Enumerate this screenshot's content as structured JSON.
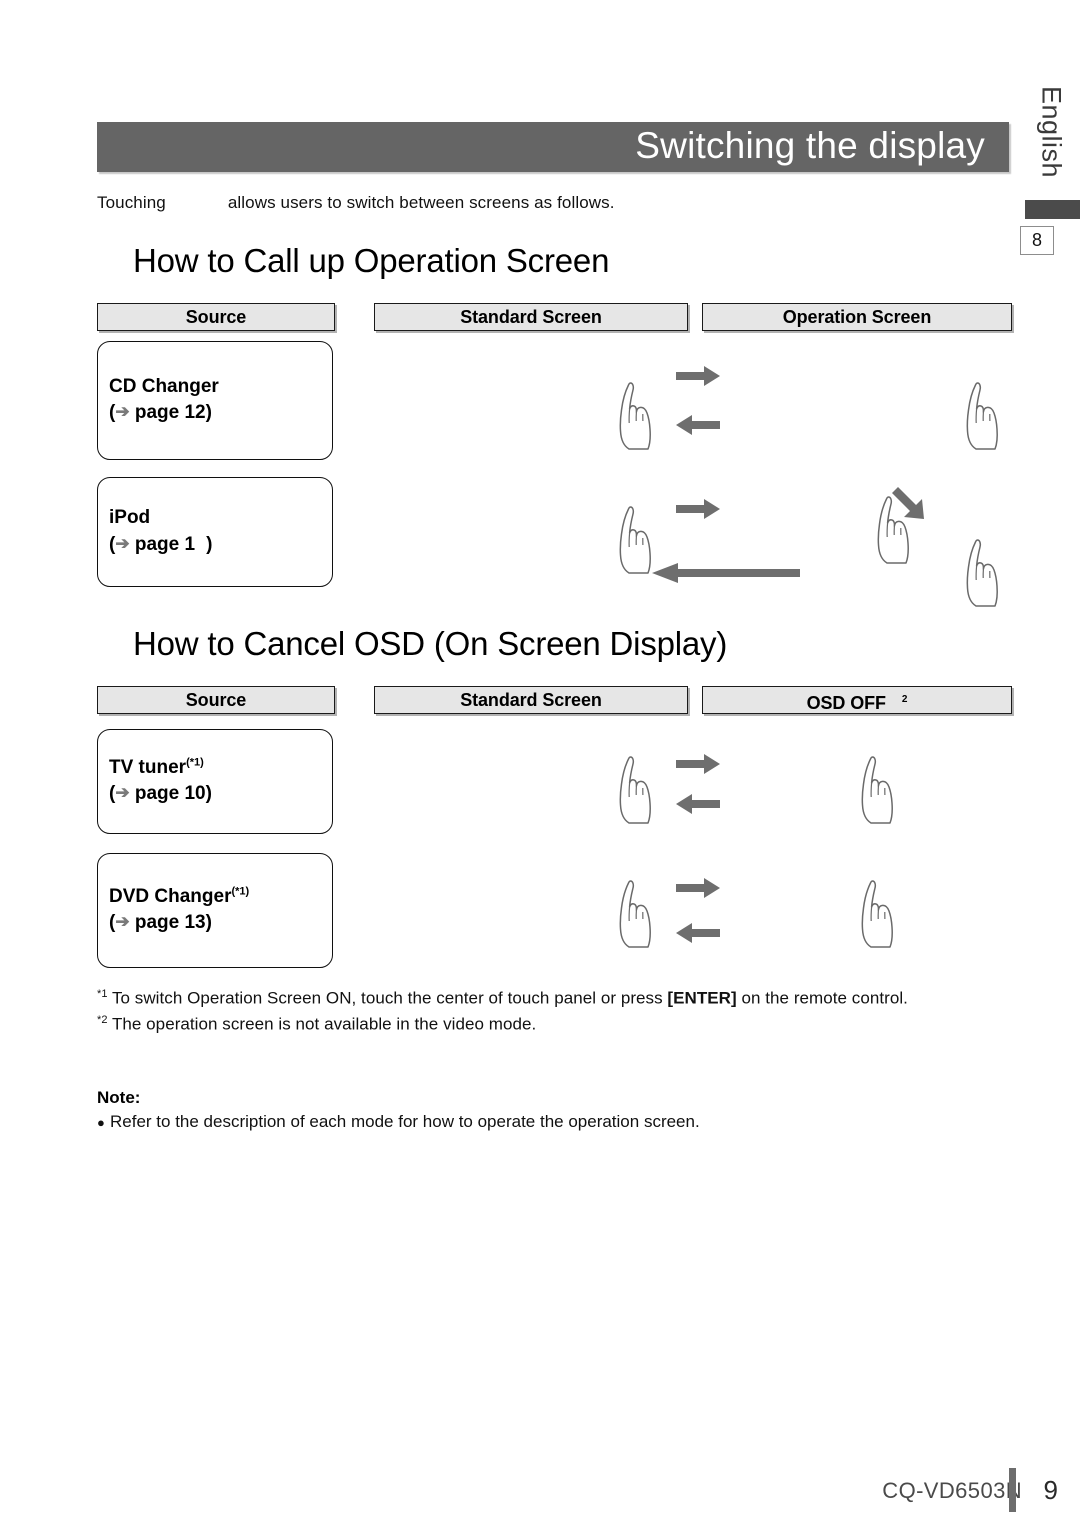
{
  "document": {
    "title": "Switching the display",
    "language_tab": "English",
    "margin_page_marker": "8",
    "intro_prefix": "Touching",
    "intro_suffix": "allows users to switch between screens as follows."
  },
  "sections": [
    {
      "heading": "How to Call up Operation Screen",
      "columns": [
        {
          "label": "Source",
          "sup": ""
        },
        {
          "label": "Standard Screen",
          "sup": ""
        },
        {
          "label": "Operation Screen",
          "sup": ""
        }
      ],
      "rows": [
        {
          "source_name": "CD Changer",
          "source_sup": "",
          "source_ref_open": "(",
          "source_ref_label": "page 12)",
          "transition": "two-way"
        },
        {
          "source_name": "iPod",
          "source_sup": "",
          "source_ref_open": "(",
          "source_ref_label": "page 1",
          "source_ref_close": ")",
          "transition": "three-state"
        }
      ]
    },
    {
      "heading": "How to Cancel OSD (On Screen Display)",
      "columns": [
        {
          "label": "Source",
          "sup": ""
        },
        {
          "label": "Standard Screen",
          "sup": ""
        },
        {
          "label": "OSD OFF",
          "sup": "2"
        }
      ],
      "rows": [
        {
          "source_name": "TV tuner",
          "source_sup": "(*1)",
          "source_ref_open": "(",
          "source_ref_label": "page 10)",
          "transition": "two-way"
        },
        {
          "source_name": "DVD Changer",
          "source_sup": "(*1)",
          "source_ref_open": "(",
          "source_ref_label": "page 13)",
          "transition": "two-way"
        }
      ]
    }
  ],
  "footnotes": [
    {
      "mark": "*1",
      "text_before": " To switch Operation Screen ON,  touch the center of touch panel or press ",
      "emphasis": "[ENTER]",
      "text_after": " on the remote control."
    },
    {
      "mark": "*2",
      "text_before": " The operation screen is not available in the video mode.",
      "emphasis": "",
      "text_after": ""
    }
  ],
  "note": {
    "title": "Note:",
    "bullet": "●",
    "item": "Refer to the description of each mode for how to operate the operation screen."
  },
  "footer": {
    "model": "CQ-VD6503N",
    "page_number": "9"
  },
  "colors": {
    "title_bar": "#656565",
    "column_header": "#e6e6e6",
    "arrow": "#6e6e6e",
    "margin_bar": "#4b4b4b"
  }
}
